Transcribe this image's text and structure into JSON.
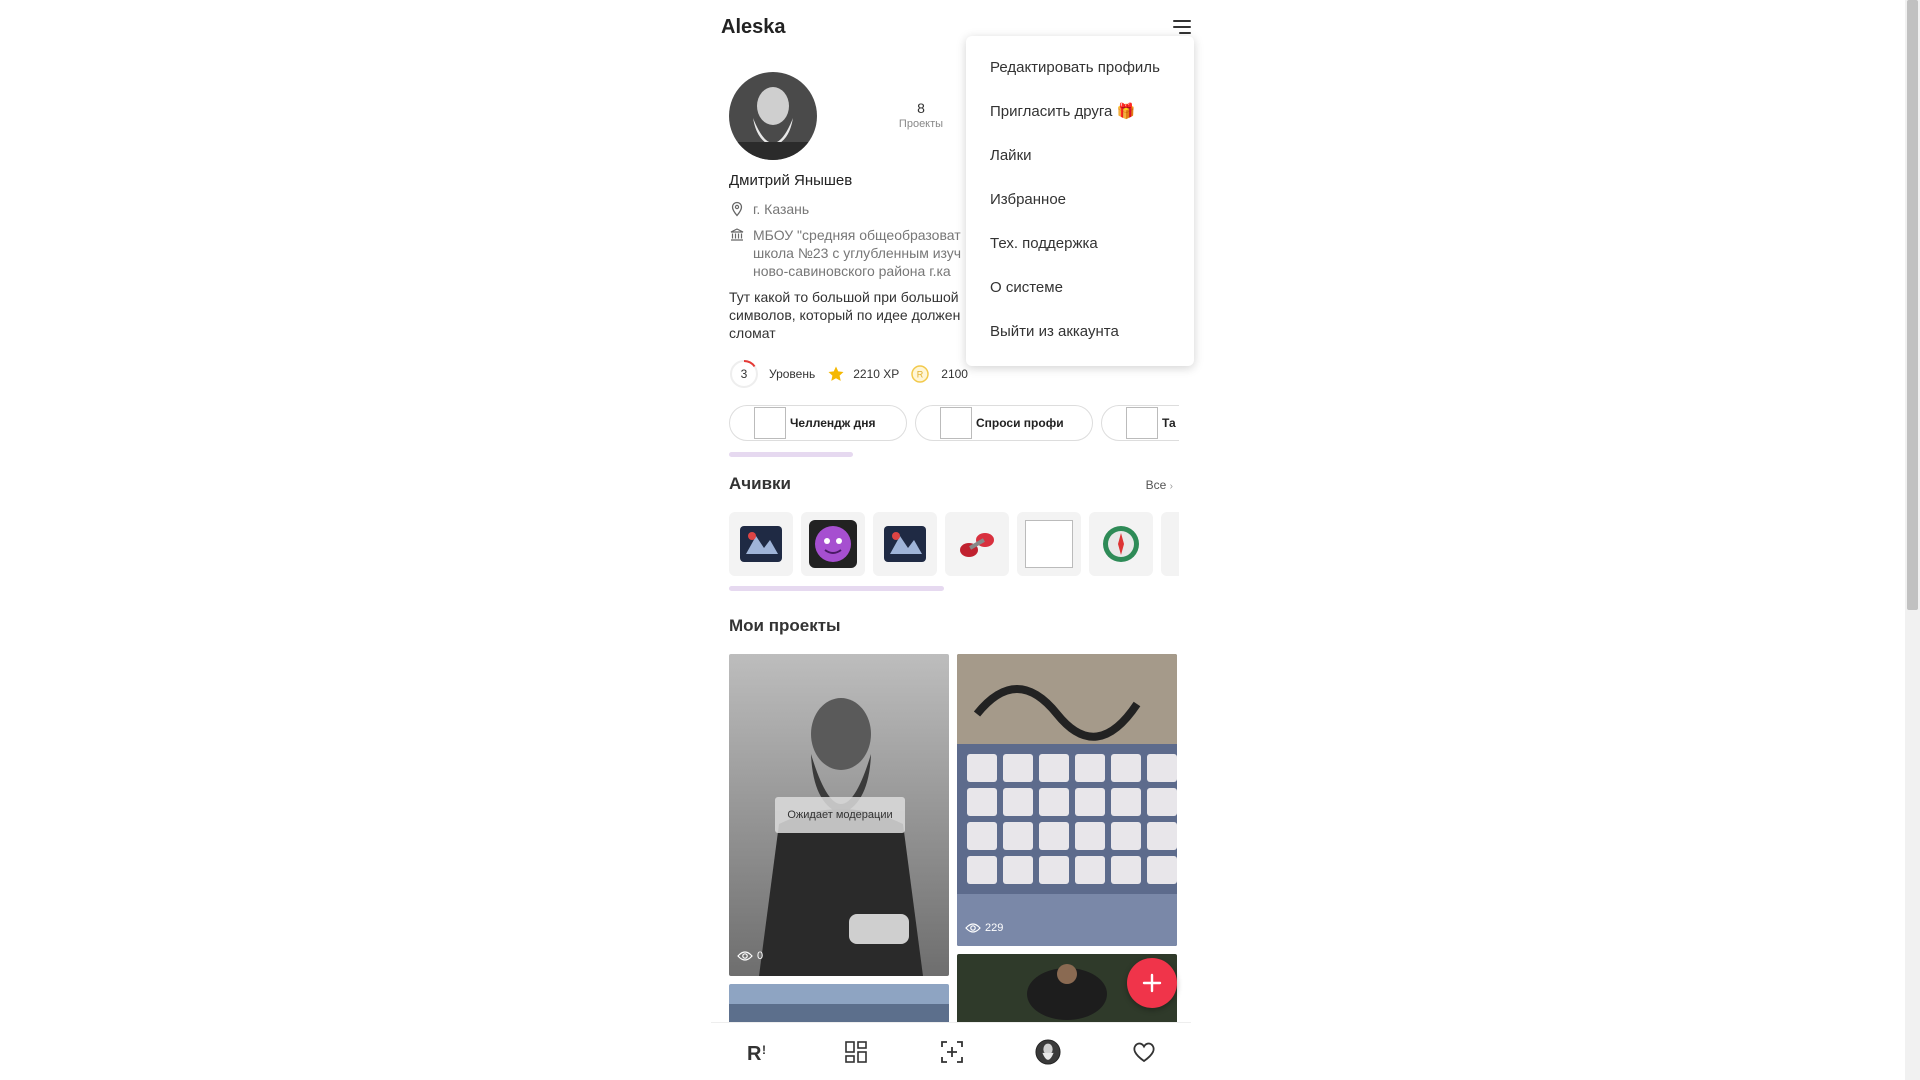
{
  "app": {
    "title": "Aleska"
  },
  "profile": {
    "name": "Дмитрий Янышев",
    "city": "г. Казань",
    "school_lines": [
      "МБОУ \"средняя общеобразоват",
      "школа №23 с углубленным изуч",
      "ново-савиновского района г.ка"
    ],
    "about": "Тут какой то большой при большой символов, который по идее должен сломат",
    "stats": {
      "projects_count": "8",
      "projects_label": "Проекты"
    }
  },
  "level": {
    "value": "3",
    "label": "Уровень",
    "xp": "2210 XP",
    "coins": "2100",
    "progress": 0.15
  },
  "chips": [
    {
      "label": "Челлендж дня"
    },
    {
      "label": "Спроси профи"
    },
    {
      "label": "Та"
    }
  ],
  "achievements": {
    "title": "Ачивки",
    "see_all": "Все"
  },
  "projects": {
    "title": "Мои проекты",
    "items": [
      {
        "status": "Ожидает модерации",
        "views": "0"
      },
      {
        "views": "229"
      }
    ]
  },
  "dropdown": {
    "items": [
      "Редактировать профиль",
      "Пригласить друга 🎁",
      "Лайки",
      "Избранное",
      "Тех. поддержка",
      "О системе",
      "Выйти из аккаунта"
    ]
  },
  "bottom_nav": {
    "items": [
      "logo-icon",
      "feed-icon",
      "add-project-icon",
      "profile-avatar",
      "likes-heart-icon"
    ]
  },
  "colors": {
    "accent": "#f0344a",
    "level_ring": "#e53935",
    "star": "#f5b800",
    "coin": "#f2c94c"
  }
}
